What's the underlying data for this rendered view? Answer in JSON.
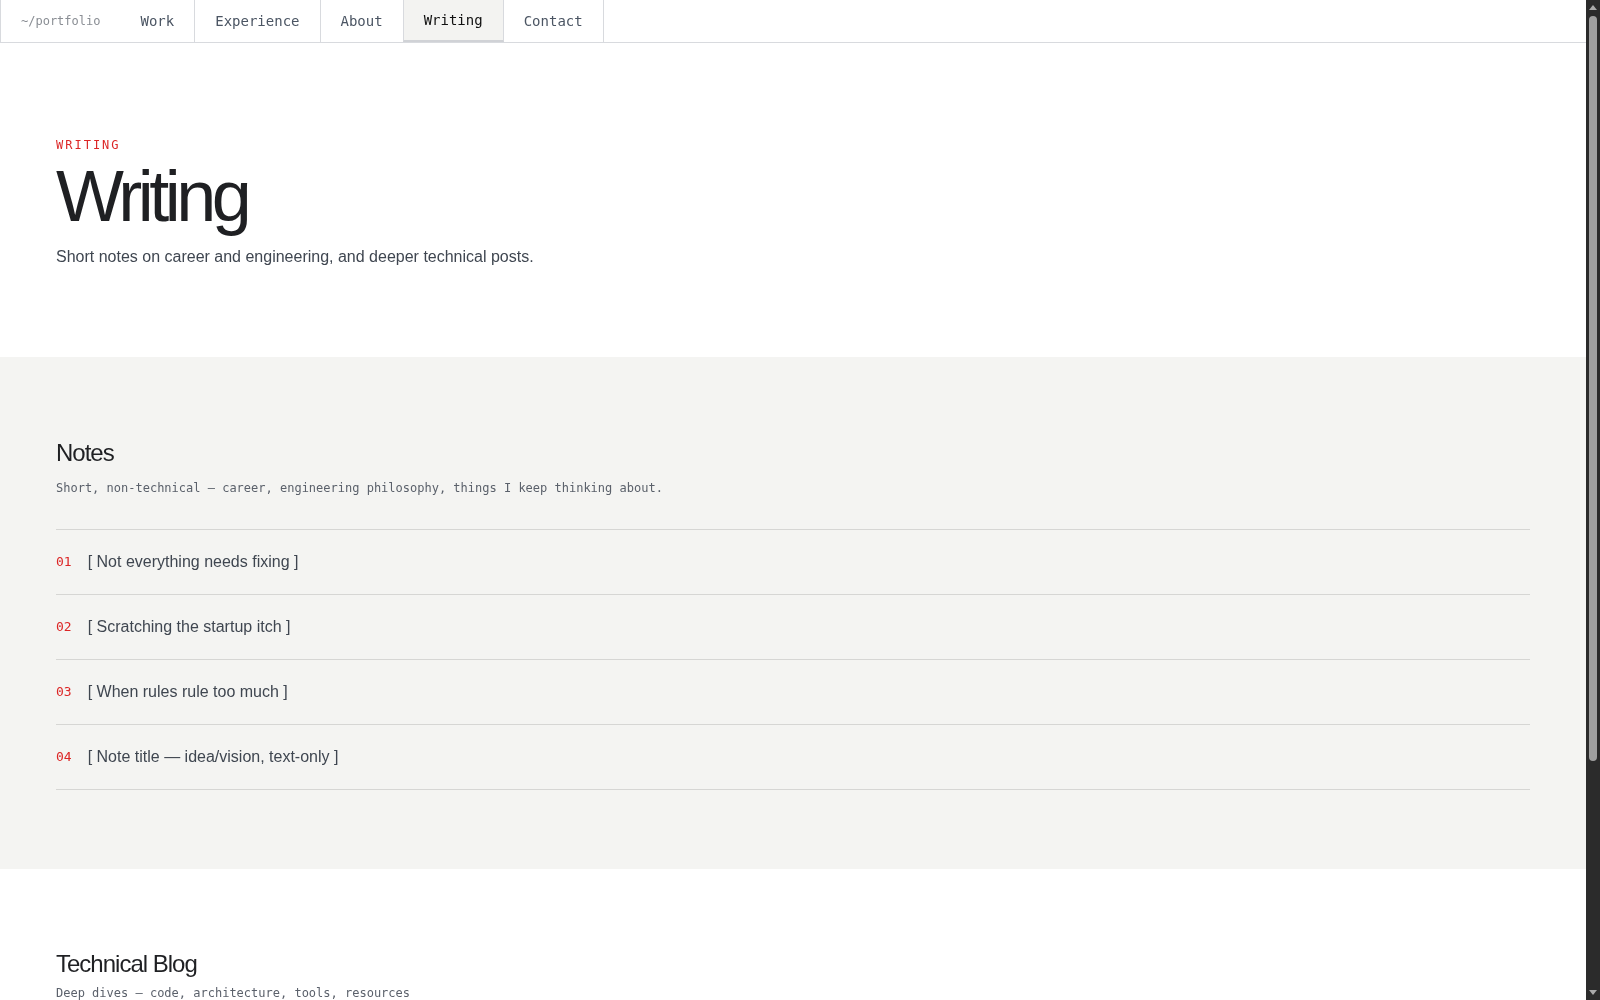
{
  "nav": {
    "logo": "~/portfolio",
    "tabs": [
      {
        "label": "Work",
        "selected": false
      },
      {
        "label": "Experience",
        "selected": false
      },
      {
        "label": "About",
        "selected": false
      },
      {
        "label": "Writing",
        "selected": true
      },
      {
        "label": "Contact",
        "selected": false
      }
    ]
  },
  "hero": {
    "eyebrow": "WRITING",
    "title": "Writing",
    "subtitle": "Short notes on career and engineering, and deeper technical posts."
  },
  "notes": {
    "title": "Notes",
    "description": "Short, non-technical — career, engineering philosophy, things I keep thinking about.",
    "items": [
      {
        "number": "01",
        "title": "[ Not everything needs fixing ]"
      },
      {
        "number": "02",
        "title": "[ Scratching the startup itch ]"
      },
      {
        "number": "03",
        "title": "[ When rules rule too much ]"
      },
      {
        "number": "04",
        "title": "[ Note title — idea/vision, text-only ]"
      }
    ]
  },
  "blog": {
    "title": "Technical Blog",
    "description": "Deep dives — code, architecture, tools, resources"
  }
}
